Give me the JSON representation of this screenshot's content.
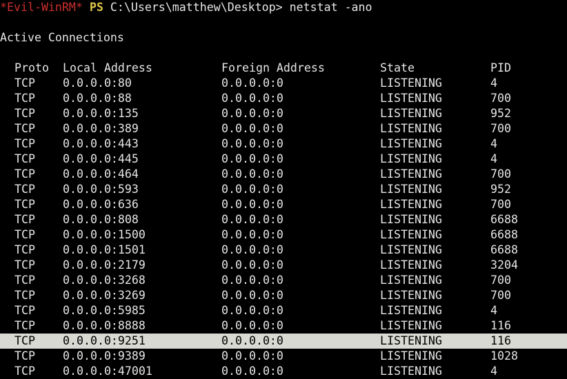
{
  "prompt": {
    "session": "*Evil-WinRM*",
    "shell": "PS",
    "path": "C:\\Users\\matthew\\Desktop>",
    "command": "netstat -ano"
  },
  "section_title": "Active Connections",
  "columns": {
    "proto": "Proto",
    "local": "Local Address",
    "foreign": "Foreign Address",
    "state": "State",
    "pid": "PID"
  },
  "rows": [
    {
      "proto": "TCP",
      "local": "0.0.0.0:80",
      "foreign": "0.0.0.0:0",
      "state": "LISTENING",
      "pid": "4"
    },
    {
      "proto": "TCP",
      "local": "0.0.0.0:88",
      "foreign": "0.0.0.0:0",
      "state": "LISTENING",
      "pid": "700"
    },
    {
      "proto": "TCP",
      "local": "0.0.0.0:135",
      "foreign": "0.0.0.0:0",
      "state": "LISTENING",
      "pid": "952"
    },
    {
      "proto": "TCP",
      "local": "0.0.0.0:389",
      "foreign": "0.0.0.0:0",
      "state": "LISTENING",
      "pid": "700"
    },
    {
      "proto": "TCP",
      "local": "0.0.0.0:443",
      "foreign": "0.0.0.0:0",
      "state": "LISTENING",
      "pid": "4"
    },
    {
      "proto": "TCP",
      "local": "0.0.0.0:445",
      "foreign": "0.0.0.0:0",
      "state": "LISTENING",
      "pid": "4"
    },
    {
      "proto": "TCP",
      "local": "0.0.0.0:464",
      "foreign": "0.0.0.0:0",
      "state": "LISTENING",
      "pid": "700"
    },
    {
      "proto": "TCP",
      "local": "0.0.0.0:593",
      "foreign": "0.0.0.0:0",
      "state": "LISTENING",
      "pid": "952"
    },
    {
      "proto": "TCP",
      "local": "0.0.0.0:636",
      "foreign": "0.0.0.0:0",
      "state": "LISTENING",
      "pid": "700"
    },
    {
      "proto": "TCP",
      "local": "0.0.0.0:808",
      "foreign": "0.0.0.0:0",
      "state": "LISTENING",
      "pid": "6688"
    },
    {
      "proto": "TCP",
      "local": "0.0.0.0:1500",
      "foreign": "0.0.0.0:0",
      "state": "LISTENING",
      "pid": "6688"
    },
    {
      "proto": "TCP",
      "local": "0.0.0.0:1501",
      "foreign": "0.0.0.0:0",
      "state": "LISTENING",
      "pid": "6688"
    },
    {
      "proto": "TCP",
      "local": "0.0.0.0:2179",
      "foreign": "0.0.0.0:0",
      "state": "LISTENING",
      "pid": "3204"
    },
    {
      "proto": "TCP",
      "local": "0.0.0.0:3268",
      "foreign": "0.0.0.0:0",
      "state": "LISTENING",
      "pid": "700"
    },
    {
      "proto": "TCP",
      "local": "0.0.0.0:3269",
      "foreign": "0.0.0.0:0",
      "state": "LISTENING",
      "pid": "700"
    },
    {
      "proto": "TCP",
      "local": "0.0.0.0:5985",
      "foreign": "0.0.0.0:0",
      "state": "LISTENING",
      "pid": "4"
    },
    {
      "proto": "TCP",
      "local": "0.0.0.0:8888",
      "foreign": "0.0.0.0:0",
      "state": "LISTENING",
      "pid": "116"
    },
    {
      "proto": "TCP",
      "local": "0.0.0.0:9251",
      "foreign": "0.0.0.0:0",
      "state": "LISTENING",
      "pid": "116",
      "highlighted": true
    },
    {
      "proto": "TCP",
      "local": "0.0.0.0:9389",
      "foreign": "0.0.0.0:0",
      "state": "LISTENING",
      "pid": "1028"
    },
    {
      "proto": "TCP",
      "local": "0.0.0.0:47001",
      "foreign": "0.0.0.0:0",
      "state": "LISTENING",
      "pid": "4"
    }
  ],
  "colors": {
    "background": "#000000",
    "text": "#e6e6e6",
    "session_red": "#cd2e2e",
    "ps_yellow": "#e0c84a",
    "highlight_row": "#d7d9d2"
  }
}
